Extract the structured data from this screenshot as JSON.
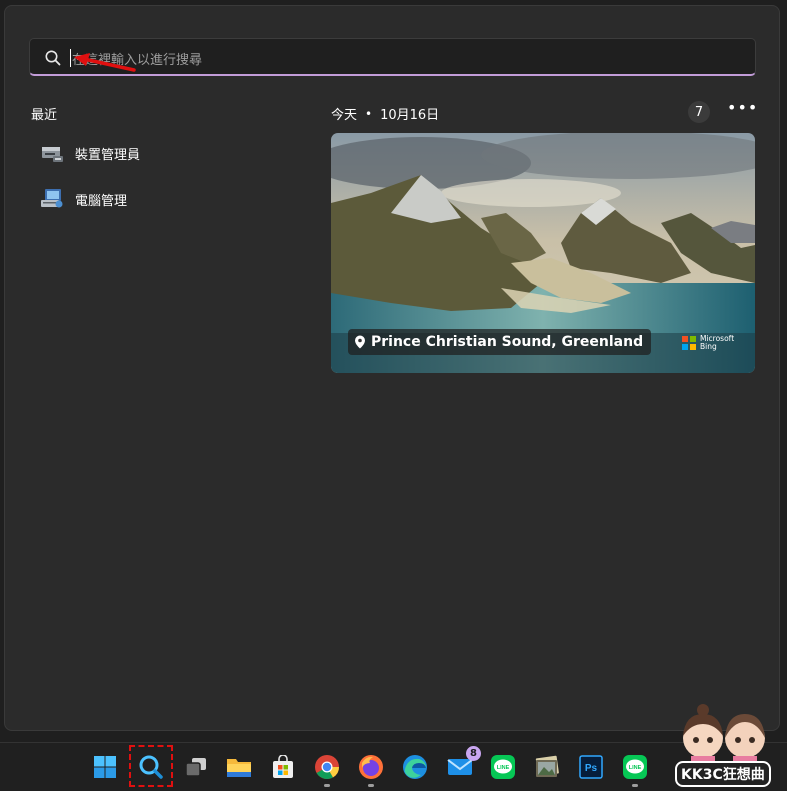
{
  "search": {
    "placeholder": "在這裡輸入以進行搜尋"
  },
  "recent": {
    "title": "最近",
    "items": [
      {
        "label": "裝置管理員",
        "icon": "device-manager-icon"
      },
      {
        "label": "電腦管理",
        "icon": "computer-management-icon"
      }
    ]
  },
  "today": {
    "label": "今天",
    "separator": "•",
    "date": "10月16日",
    "count": "7",
    "more": "•••"
  },
  "highlight": {
    "location": "Prince Christian Sound, Greenland",
    "brand_line1": "Microsoft",
    "brand_line2": "Bing"
  },
  "taskbar": {
    "mail_badge": "8",
    "line_label": "LINE",
    "ps_label": "Ps",
    "items": [
      "start-icon",
      "search-icon",
      "task-view-icon",
      "file-explorer-icon",
      "store-icon",
      "chrome-icon",
      "firefox-icon",
      "edge-icon",
      "mail-icon",
      "line-icon",
      "photos-icon",
      "photoshop-icon",
      "line-icon"
    ]
  },
  "watermark": {
    "text": "KK3C狂想曲"
  },
  "colors": {
    "accent": "#c29cd8",
    "highlight_border": "#e01010",
    "panel_bg": "#2b2b2b"
  }
}
